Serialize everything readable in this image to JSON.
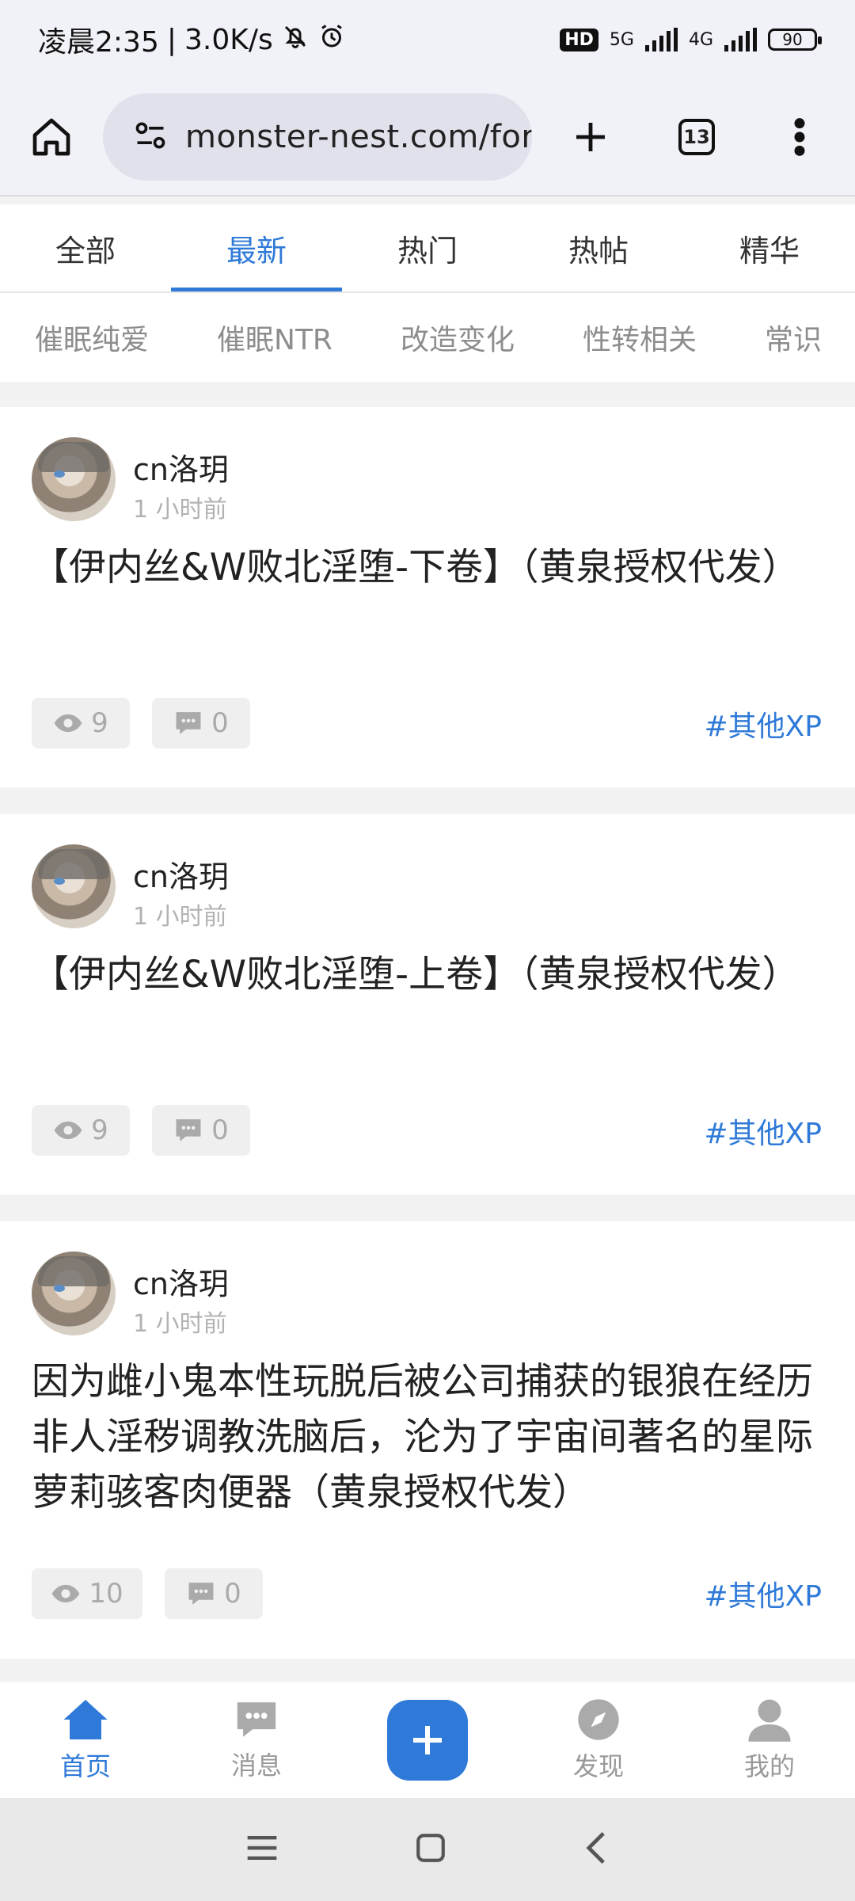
{
  "status": {
    "time": "凌晨2:35",
    "separator": "|",
    "speed": "3.0K/s",
    "hd": "HD",
    "net1": "5G",
    "net2": "4G",
    "battery": "90"
  },
  "browser": {
    "url": "monster-nest.com/forum",
    "tab_count": "13"
  },
  "tabs": [
    {
      "label": "全部"
    },
    {
      "label": "最新"
    },
    {
      "label": "热门"
    },
    {
      "label": "热帖"
    },
    {
      "label": "精华"
    }
  ],
  "subtabs": [
    {
      "label": "催眠纯爱"
    },
    {
      "label": "催眠NTR"
    },
    {
      "label": "改造变化"
    },
    {
      "label": "性转相关"
    },
    {
      "label": "常识"
    }
  ],
  "posts": [
    {
      "author": "cn洛玥",
      "time": "1 小时前",
      "title": "【伊内丝&W败北淫堕-下卷】（黄泉授权代发）",
      "views": "9",
      "comments": "0",
      "tag": "#其他XP"
    },
    {
      "author": "cn洛玥",
      "time": "1 小时前",
      "title": "【伊内丝&W败北淫堕-上卷】（黄泉授权代发）",
      "views": "9",
      "comments": "0",
      "tag": "#其他XP"
    },
    {
      "author": "cn洛玥",
      "time": "1 小时前",
      "title": "因为雌小鬼本性玩脱后被公司捕获的银狼在经历非人淫秽调教洗脑后，沦为了宇宙间著名的星际萝莉骇客肉便器（黄泉授权代发）",
      "views": "10",
      "comments": "0",
      "tag": "#其他XP"
    }
  ],
  "bottom_nav": {
    "home": "首页",
    "messages": "消息",
    "discover": "发现",
    "mine": "我的"
  },
  "colors": {
    "accent": "#2f7ad8",
    "muted": "#999999"
  }
}
